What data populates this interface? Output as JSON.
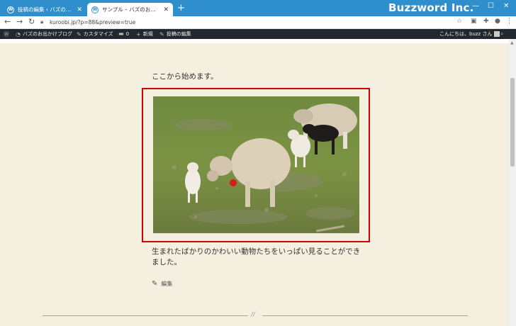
{
  "browser": {
    "tabs": [
      {
        "title": "投稿の編集 ‹ バズのお出かけブログ",
        "close": "✕",
        "active": false
      },
      {
        "title": "サンプル – バズのお出かけブログ",
        "close": "✕",
        "active": true
      }
    ],
    "new_tab": "+",
    "brand": "Buzzword Inc.",
    "url": "kuroobi.jp/?p=88&preview=true"
  },
  "adminbar": {
    "site_name": "バズのお出かけブログ",
    "customize": "カスタマイズ",
    "comments_count": "0",
    "new": "新規",
    "edit_post": "投稿の編集",
    "greeting": "こんにちは、buzz さん"
  },
  "post": {
    "intro": "ここから始めます。",
    "caption": "生まれたばかりのかわいい動物たちをいっぱい見ることができました。",
    "edit_link": "編集",
    "separator": "//"
  },
  "colors": {
    "titlebar": "#2f8ecc",
    "adminbar": "#23282d",
    "page_bg": "#f5efe0",
    "highlight_border": "#d40000"
  }
}
